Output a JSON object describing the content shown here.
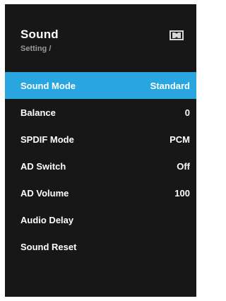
{
  "header": {
    "title": "Sound",
    "breadcrumb": "Setting /",
    "logo_icon": "dolby-logo-icon"
  },
  "colors": {
    "panel": "#171717",
    "highlight": "#29a6e0",
    "breadcrumb": "#9a9a9a"
  },
  "menu": {
    "items": [
      {
        "label": "Sound Mode",
        "value": "Standard",
        "selected": true
      },
      {
        "label": "Balance",
        "value": "0"
      },
      {
        "label": "SPDIF Mode",
        "value": "PCM"
      },
      {
        "label": "AD Switch",
        "value": "Off"
      },
      {
        "label": "AD Volume",
        "value": "100"
      },
      {
        "label": "Audio Delay",
        "value": ""
      },
      {
        "label": "Sound Reset",
        "value": ""
      }
    ]
  }
}
